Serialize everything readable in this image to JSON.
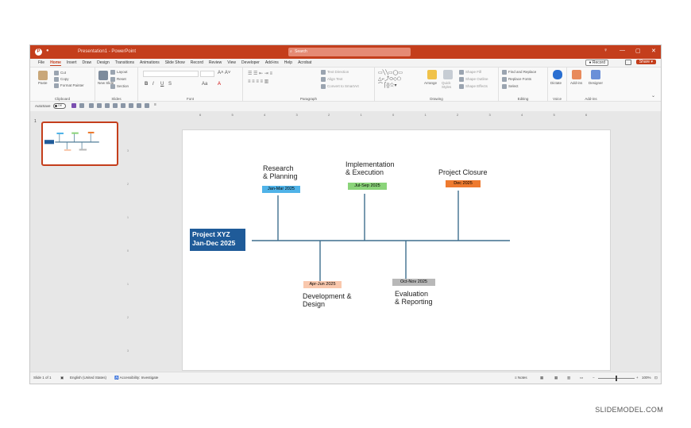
{
  "window": {
    "app_icon": "P",
    "doc_title": "Presentation1 - PowerPoint",
    "search_placeholder": "Search",
    "win_controls": [
      "—",
      "▢",
      "✕"
    ]
  },
  "menu": {
    "tabs": [
      "File",
      "Home",
      "Insert",
      "Draw",
      "Design",
      "Transitions",
      "Animations",
      "Slide Show",
      "Record",
      "Review",
      "View",
      "Developer",
      "Add-ins",
      "Help",
      "Acrobat"
    ],
    "active_tab": "Home",
    "record_label": "Record",
    "share_label": "Share"
  },
  "ribbon": {
    "clipboard": {
      "label": "Clipboard",
      "paste": "Paste",
      "cut": "Cut",
      "copy": "Copy",
      "format_painter": "Format Painter"
    },
    "slides": {
      "label": "Slides",
      "new_slide": "New Slide",
      "layout": "Layout",
      "reset": "Reset",
      "section": "Section"
    },
    "font": {
      "label": "Font"
    },
    "paragraph": {
      "label": "Paragraph",
      "text_direction": "Text Direction",
      "align_text": "Align Text",
      "convert_smartart": "Convert to SmartArt"
    },
    "drawing": {
      "label": "Drawing",
      "arrange": "Arrange",
      "quick_styles": "Quick Styles",
      "shape_fill": "Shape Fill",
      "shape_outline": "Shape Outline",
      "shape_effects": "Shape Effects"
    },
    "editing": {
      "label": "Editing",
      "find_replace": "Find and Replace",
      "replace_fonts": "Replace Fonts",
      "select": "Select"
    },
    "voice": {
      "label": "Voice",
      "dictate": "Dictate"
    },
    "addins": {
      "label": "Add-ins",
      "addins_btn": "Add-ins",
      "designer": "Designer"
    }
  },
  "qat": {
    "autosave": "AutoSave",
    "toggle": "Off"
  },
  "ruler": {
    "h_ticks": [
      "6",
      "5",
      "4",
      "3",
      "2",
      "1",
      "0",
      "1",
      "2",
      "3",
      "4",
      "5",
      "6"
    ],
    "v_ticks": [
      "3",
      "2",
      "1",
      "0",
      "1",
      "2",
      "3"
    ]
  },
  "thumbnail": {
    "number": "1"
  },
  "slide": {
    "main_label_line1": "Project XYZ",
    "main_label_line2": "Jan-Dec 2025",
    "milestones_top": [
      {
        "title_line1": "Research",
        "title_line2": "& Planning",
        "date": "Jan-Mar 2025",
        "color": "#4fb3e8"
      },
      {
        "title_line1": "Implementation",
        "title_line2": "& Execution",
        "date": "Jul-Sep 2025",
        "color": "#8bd47a"
      },
      {
        "title_line1": "Project Closure",
        "title_line2": "",
        "date": "Dec 2025",
        "color": "#ee7a2f"
      }
    ],
    "milestones_bottom": [
      {
        "date": "Apr-Jun 2025",
        "title_line1": "Development &",
        "title_line2": "Design",
        "color": "#f9c8ad"
      },
      {
        "date": "Oct-Nov 2025",
        "title_line1": "Evaluation",
        "title_line2": "& Reporting",
        "color": "#b8b8b8"
      }
    ],
    "colors": {
      "spine": "#3e6f8e",
      "main_box": "#1f5b99"
    }
  },
  "status": {
    "slide_count": "Slide 1 of 1",
    "language": "English (United States)",
    "accessibility": "Accessibility: Investigate",
    "notes": "Notes",
    "zoom": "100%"
  },
  "credit": "SLIDEMODEL.COM"
}
